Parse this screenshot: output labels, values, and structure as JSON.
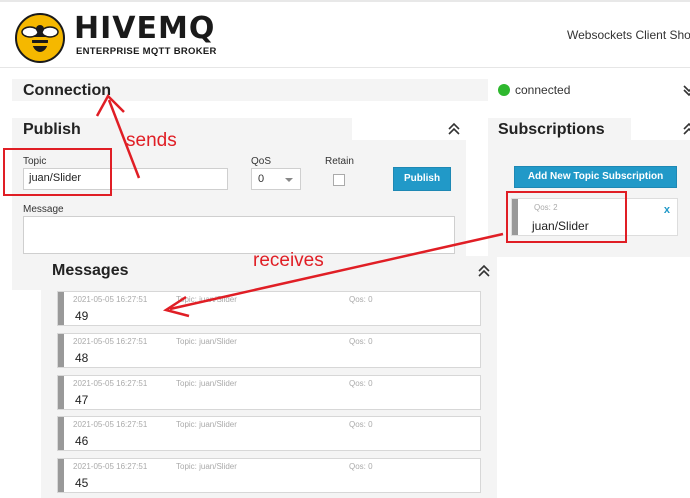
{
  "header": {
    "logo_word": "HIVEMQ",
    "logo_sub": "ENTERPRISE MQTT BROKER",
    "title": "Websockets Client Show"
  },
  "connection": {
    "title": "Connection",
    "status": "connected",
    "status_color": "#2eb82e"
  },
  "publish": {
    "title": "Publish",
    "topic_label": "Topic",
    "topic_value": "juan/Slider",
    "qos_label": "QoS",
    "qos_value": "0",
    "retain_label": "Retain",
    "button_label": "Publish",
    "message_label": "Message",
    "message_value": ""
  },
  "subscriptions": {
    "title": "Subscriptions",
    "add_button_label": "Add New Topic Subscription",
    "items": [
      {
        "qos": "Qos: 2",
        "topic": "juan/Slider",
        "remove": "x"
      }
    ]
  },
  "messages": {
    "title": "Messages",
    "items": [
      {
        "time": "2021-05-05 16:27:51",
        "topic": "Topic: juan/Slider",
        "qos": "Qos: 0",
        "payload": "49"
      },
      {
        "time": "2021-05-05 16:27:51",
        "topic": "Topic: juan/Slider",
        "qos": "Qos: 0",
        "payload": "48"
      },
      {
        "time": "2021-05-05 16:27:51",
        "topic": "Topic: juan/Slider",
        "qos": "Qos: 0",
        "payload": "47"
      },
      {
        "time": "2021-05-05 16:27:51",
        "topic": "Topic: juan/Slider",
        "qos": "Qos: 0",
        "payload": "46"
      },
      {
        "time": "2021-05-05 16:27:51",
        "topic": "Topic: juan/Slider",
        "qos": "Qos: 0",
        "payload": "45"
      }
    ]
  },
  "annotations": {
    "sends": "sends",
    "receives": "receives",
    "color": "#e01e25"
  },
  "colors": {
    "accent": "#2199c8",
    "brand_yellow": "#f5b800"
  },
  "icons": {
    "logo": "bee-icon",
    "collapse": "chevron-up-double-icon"
  }
}
